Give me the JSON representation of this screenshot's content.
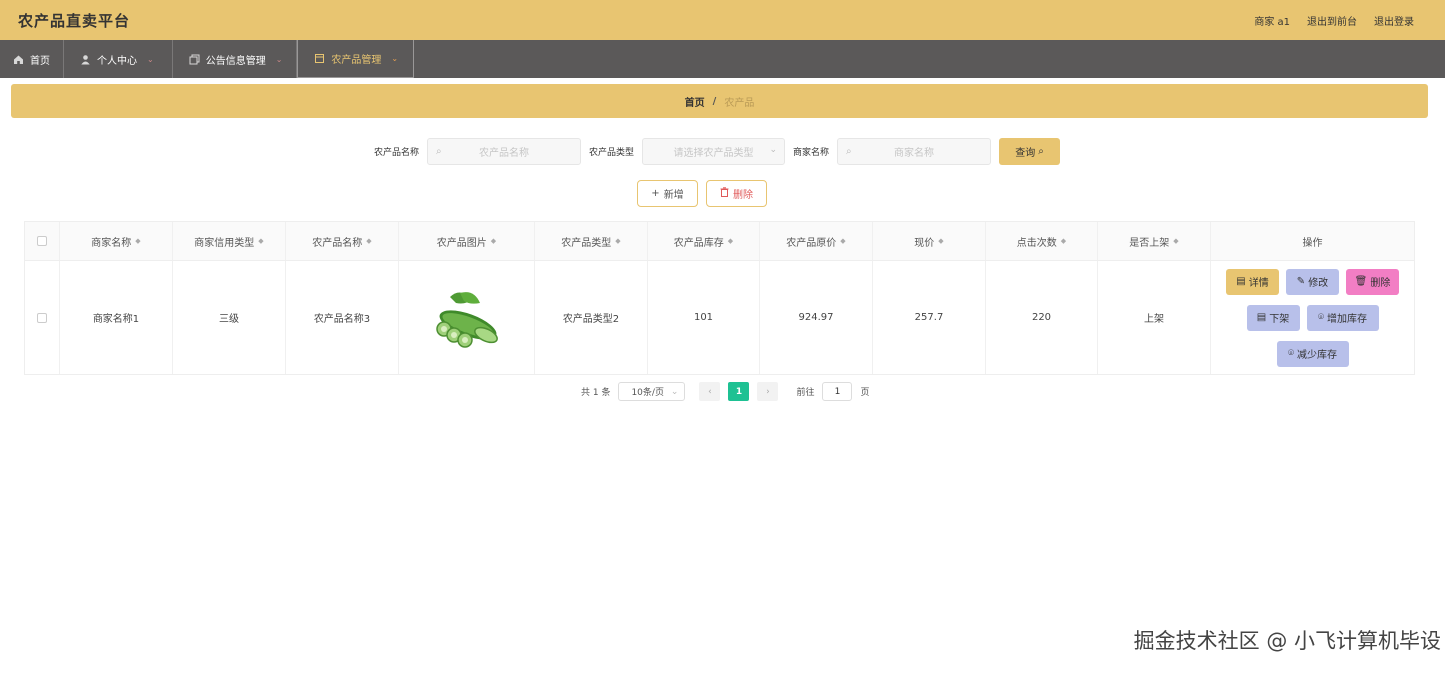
{
  "header": {
    "title": "农产品直卖平台",
    "user_label": "商家 a1",
    "back_label": "退出到前台",
    "logout_label": "退出登录"
  },
  "nav": {
    "home": "首页",
    "personal": "个人中心",
    "notice": "公告信息管理",
    "product": "农产品管理"
  },
  "breadcrumb": {
    "home": "首页",
    "separator": "/",
    "current": "农产品"
  },
  "search": {
    "name_label": "农产品名称",
    "name_placeholder": "农产品名称",
    "type_label": "农产品类型",
    "type_placeholder": "请选择农产品类型",
    "merchant_label": "商家名称",
    "merchant_placeholder": "商家名称",
    "query_label": "查询"
  },
  "actions": {
    "add": "新增",
    "delete": "删除"
  },
  "table": {
    "headers": [
      "商家名称",
      "商家信用类型",
      "农产品名称",
      "农产品图片",
      "农产品类型",
      "农产品库存",
      "农产品原价",
      "现价",
      "点击次数",
      "是否上架",
      "操作"
    ],
    "rows": [
      {
        "merchant": "商家名称1",
        "credit": "三级",
        "name": "农产品名称3",
        "image": "cucumber-image",
        "type": "农产品类型2",
        "stock": "101",
        "original_price": "924.97",
        "price": "257.7",
        "clicks": "220",
        "on_shelf": "上架"
      }
    ],
    "ops": {
      "detail": "详情",
      "edit": "修改",
      "delete": "删除",
      "off_shelf": "下架",
      "inc_stock": "增加库存",
      "dec_stock": "减少库存"
    }
  },
  "pagination": {
    "total": "共 1 条",
    "page_size": "10条/页",
    "current_page": "1",
    "goto_label": "前往",
    "goto_value": "1",
    "page_suffix": "页"
  },
  "watermark": "掘金技术社区 @ 小飞计算机毕设",
  "colors": {
    "accent": "#e8c571",
    "nav_bg": "#5b5959",
    "op_blue": "#b8c0ea",
    "op_pink": "#f27ec4",
    "pager_active": "#1ec193"
  }
}
